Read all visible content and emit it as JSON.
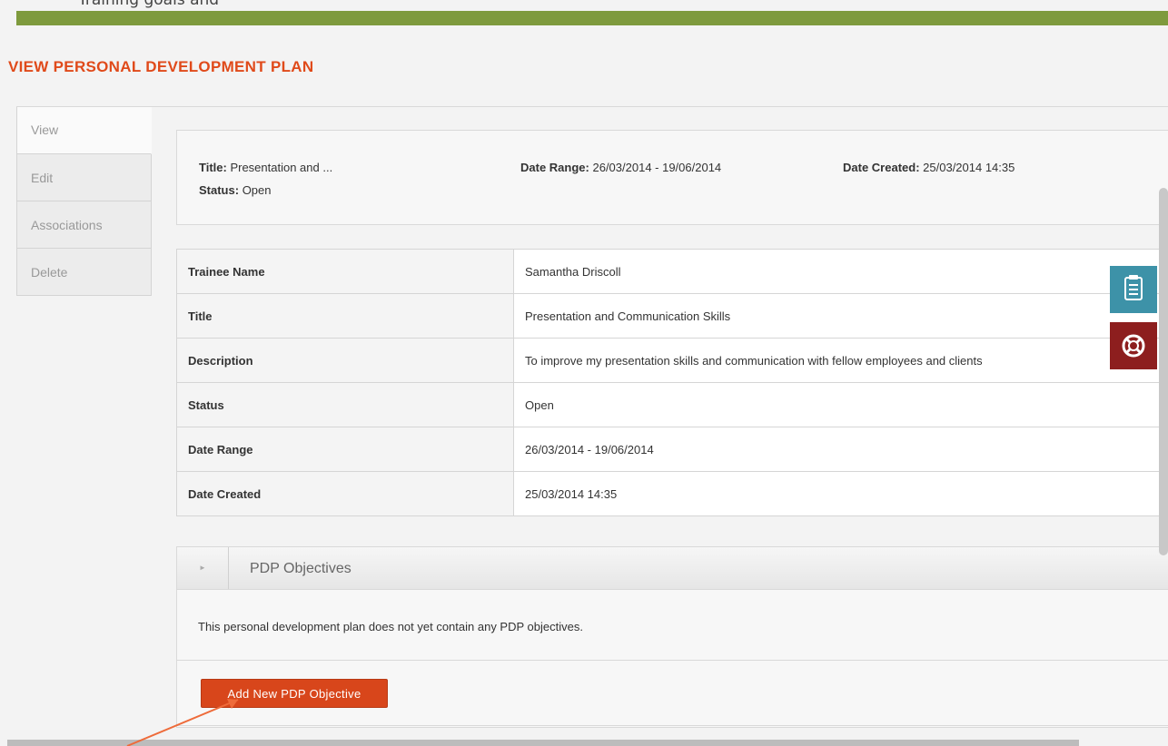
{
  "page": {
    "top_clip_text": "Training goals and",
    "title": "VIEW PERSONAL DEVELOPMENT PLAN"
  },
  "tabs": [
    {
      "label": "View",
      "active": true
    },
    {
      "label": "Edit",
      "active": false
    },
    {
      "label": "Associations",
      "active": false
    },
    {
      "label": "Delete",
      "active": false
    }
  ],
  "summary": {
    "title_label": "Title:",
    "title_value": "Presentation and ...",
    "status_label": "Status:",
    "status_value": "Open",
    "date_range_label": "Date Range:",
    "date_range_value": "26/03/2014 - 19/06/2014",
    "date_created_label": "Date Created:",
    "date_created_value": "25/03/2014 14:35"
  },
  "details": [
    {
      "key": "Trainee Name",
      "value": "Samantha Driscoll"
    },
    {
      "key": "Title",
      "value": "Presentation and Communication Skills"
    },
    {
      "key": "Description",
      "value": "To improve my presentation skills and communication with fellow employees and clients"
    },
    {
      "key": "Status",
      "value": "Open"
    },
    {
      "key": "Date Range",
      "value": "26/03/2014 - 19/06/2014"
    },
    {
      "key": "Date Created",
      "value": "25/03/2014 14:35"
    }
  ],
  "objectives": {
    "heading": "PDP Objectives",
    "empty_message": "This personal development plan does not yet contain any PDP objectives.",
    "add_button": "Add New PDP Objective"
  },
  "side_buttons": [
    {
      "icon": "clipboard-icon",
      "color": "#3d92a8"
    },
    {
      "icon": "lifebuoy-icon",
      "color": "#8d1e1e"
    }
  ],
  "colors": {
    "accent": "#e04a1a",
    "topbar": "#7e9a3d",
    "button": "#d8461b"
  }
}
